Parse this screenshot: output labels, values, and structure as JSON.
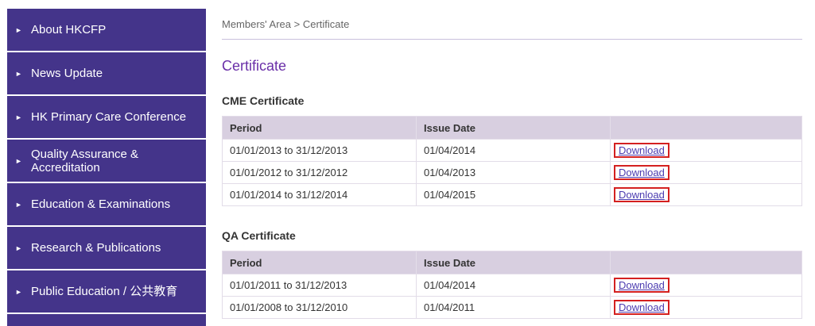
{
  "sidebar": {
    "items": [
      {
        "label": "About HKCFP"
      },
      {
        "label": "News Update"
      },
      {
        "label": "HK Primary Care Conference"
      },
      {
        "label": "Quality Assurance & Accreditation"
      },
      {
        "label": "Education & Examinations"
      },
      {
        "label": "Research & Publications"
      },
      {
        "label": "Public Education / 公共教育"
      }
    ],
    "arrow_glyph": "►"
  },
  "breadcrumb": "Members' Area > Certificate",
  "page_title": "Certificate",
  "cme": {
    "heading": "CME Certificate",
    "columns": [
      "Period",
      "Issue Date",
      ""
    ],
    "rows": [
      {
        "period": "01/01/2013 to 31/12/2013",
        "issue_date": "01/04/2014",
        "link": "Download"
      },
      {
        "period": "01/01/2012 to 31/12/2012",
        "issue_date": "01/04/2013",
        "link": "Download"
      },
      {
        "period": "01/01/2014 to 31/12/2014",
        "issue_date": "01/04/2015",
        "link": "Download"
      }
    ]
  },
  "qa": {
    "heading": "QA Certificate",
    "columns": [
      "Period",
      "Issue Date",
      ""
    ],
    "rows": [
      {
        "period": "01/01/2011 to 31/12/2013",
        "issue_date": "01/04/2014",
        "link": "Download"
      },
      {
        "period": "01/01/2008 to 31/12/2010",
        "issue_date": "01/04/2011",
        "link": "Download"
      }
    ]
  },
  "colors": {
    "nav_bg": "#44348a",
    "title": "#6a2fa8",
    "table_header_bg": "#d8cfe0",
    "highlight_border": "#d42020"
  }
}
